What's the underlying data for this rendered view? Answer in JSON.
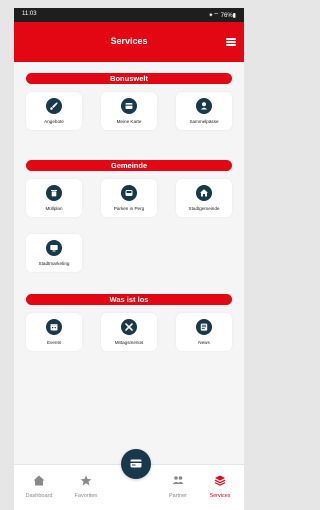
{
  "status": {
    "time": "11:03",
    "indicators": "⁕⌔ 76%▮"
  },
  "header": {
    "title": "Services"
  },
  "sections": [
    {
      "title": "Bonuswelt",
      "items": [
        {
          "label": "Angebote",
          "icon": "rocket-icon"
        },
        {
          "label": "Meine Karte",
          "icon": "card-icon"
        },
        {
          "label": "Sammelpässe",
          "icon": "user-icon"
        }
      ]
    },
    {
      "title": "Gemeinde",
      "items": [
        {
          "label": "Müllplan",
          "icon": "trash-icon"
        },
        {
          "label": "Parken in Perg",
          "icon": "car-icon"
        },
        {
          "label": "Stadtgemeinde",
          "icon": "home-icon"
        },
        {
          "label": "Stadtmarketing",
          "icon": "monitor-icon"
        }
      ]
    },
    {
      "title": "Was ist los",
      "items": [
        {
          "label": "Events",
          "icon": "calendar-icon"
        },
        {
          "label": "Mittagsmenüs",
          "icon": "cutlery-icon"
        },
        {
          "label": "News",
          "icon": "news-icon"
        }
      ]
    }
  ],
  "nav": [
    {
      "label": "Dashboard",
      "icon": "home-icon"
    },
    {
      "label": "Favoriten",
      "icon": "star-icon"
    },
    {
      "label": "Partner",
      "icon": "partners-icon"
    },
    {
      "label": "Services",
      "icon": "layers-icon",
      "active": true
    }
  ],
  "colors": {
    "accent": "#e30613",
    "icon_bg": "#17394b"
  }
}
